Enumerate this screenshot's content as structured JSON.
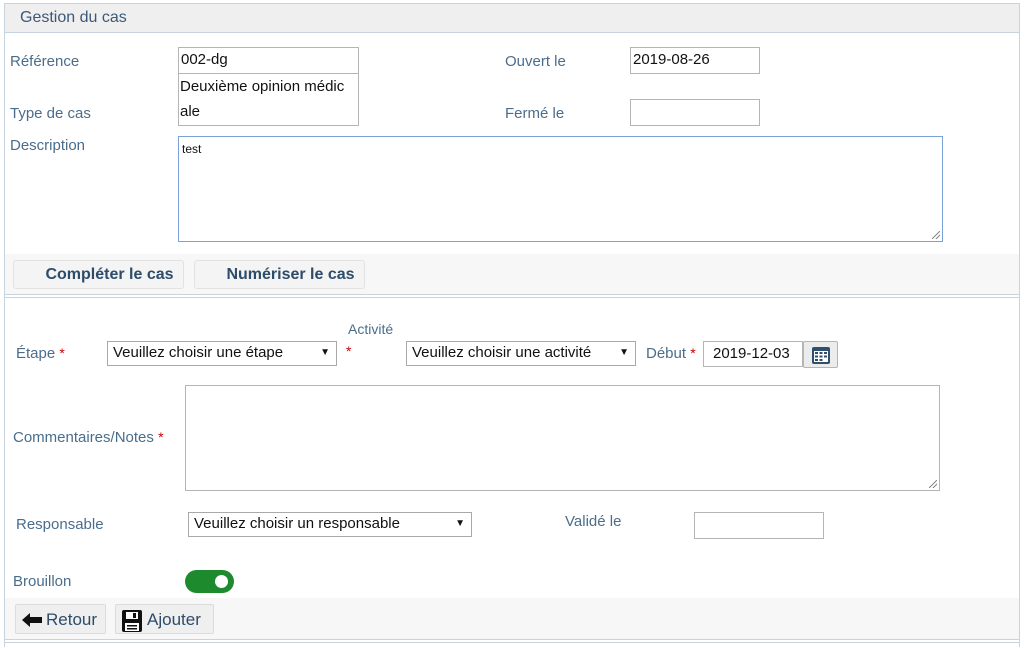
{
  "panel": {
    "title": "Gestion du cas"
  },
  "case": {
    "reference_label": "Référence",
    "reference_value": "002-dg",
    "type_label": "Type de cas",
    "type_value_line1": "Deuxième opinion médic",
    "type_value_line2": "ale",
    "opened_label": "Ouvert le",
    "opened_value": "2019-08-26",
    "closed_label": "Fermé le",
    "closed_value": "",
    "description_label": "Description",
    "description_value": "test"
  },
  "case_actions": {
    "complete_label": "Compléter le cas",
    "scan_label": "Numériser le cas"
  },
  "activity_form": {
    "step_label": "Étape",
    "step_select": "Veuillez choisir une étape",
    "activity_label": "Activité",
    "activity_select": "Veuillez choisir une activité",
    "start_label": "Début",
    "start_value": "2019-12-03",
    "comments_label": "Commentaires/Notes",
    "comments_value": "",
    "responsible_label": "Responsable",
    "responsible_select": "Veuillez choisir un responsable",
    "validated_label": "Validé le",
    "validated_value": "",
    "draft_label": "Brouillon",
    "draft_on": true,
    "required_marker": "*"
  },
  "footer": {
    "back_label": "Retour",
    "add_label": "Ajouter"
  },
  "colors": {
    "label": "#4a6d8c",
    "toggle_on": "#1e8a2e",
    "required": "#cc0000"
  }
}
